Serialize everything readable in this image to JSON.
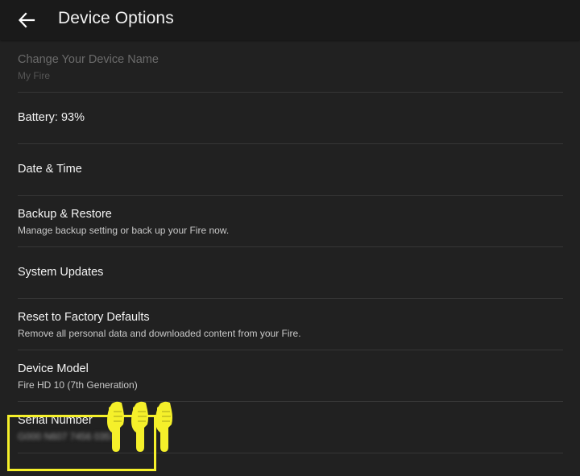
{
  "header": {
    "title": "Device Options",
    "back_icon": "arrow-left-icon"
  },
  "rows": [
    {
      "title": "Change Your Device Name",
      "subtitle": "My Fire",
      "enabled": false
    },
    {
      "title": "Battery: 93%"
    },
    {
      "title": "Date & Time"
    },
    {
      "title": "Backup & Restore",
      "subtitle": "Manage backup setting or back up your Fire now."
    },
    {
      "title": "System Updates"
    },
    {
      "title": "Reset to Factory Defaults",
      "subtitle": "Remove all personal data and downloaded content from your Fire."
    },
    {
      "title": "Device Model",
      "subtitle": "Fire HD 10 (7th Generation)"
    },
    {
      "title": "Serial Number",
      "subtitle": "G000 N607 7456 0357"
    }
  ],
  "annotation": {
    "highlight_color": "#f5f02a",
    "pointer_icon": "pointing-hand-icon"
  },
  "colors": {
    "background": "#212121",
    "header_background": "#1a1a1a",
    "divider": "#363636"
  }
}
